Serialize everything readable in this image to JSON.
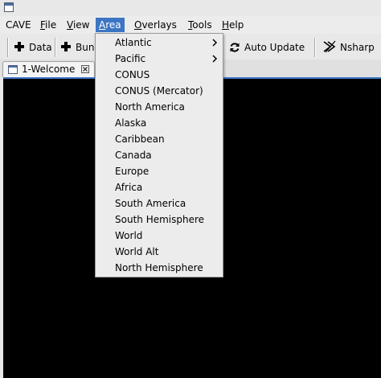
{
  "menubar": {
    "items": [
      {
        "label": "CAVE",
        "mnemonic": "",
        "rest": "CAVE"
      },
      {
        "label": "File",
        "mnemonic": "F",
        "rest": "ile"
      },
      {
        "label": "View",
        "mnemonic": "V",
        "rest": "iew"
      },
      {
        "label": "Area",
        "mnemonic": "A",
        "rest": "rea"
      },
      {
        "label": "Overlays",
        "mnemonic": "O",
        "rest": "verlays"
      },
      {
        "label": "Tools",
        "mnemonic": "T",
        "rest": "ools"
      },
      {
        "label": "Help",
        "mnemonic": "H",
        "rest": "elp"
      }
    ],
    "active": "Area"
  },
  "toolbar": {
    "data_label": "Data",
    "bundles_label": "Bun",
    "auto_update_label": "Auto Update",
    "nsharp_label": "Nsharp"
  },
  "tabs": [
    {
      "label": "1-Welcome",
      "icon": "window-icon"
    }
  ],
  "area_menu": {
    "items": [
      {
        "label": "Atlantic",
        "submenu": true
      },
      {
        "label": "Pacific",
        "submenu": true
      },
      {
        "label": "CONUS",
        "submenu": false
      },
      {
        "label": "CONUS (Mercator)",
        "submenu": false
      },
      {
        "label": "North America",
        "submenu": false
      },
      {
        "label": "Alaska",
        "submenu": false
      },
      {
        "label": "Caribbean",
        "submenu": false
      },
      {
        "label": "Canada",
        "submenu": false
      },
      {
        "label": "Europe",
        "submenu": false
      },
      {
        "label": "Africa",
        "submenu": false
      },
      {
        "label": "South America",
        "submenu": false
      },
      {
        "label": "South Hemisphere",
        "submenu": false
      },
      {
        "label": "World",
        "submenu": false
      },
      {
        "label": "World Alt",
        "submenu": false
      },
      {
        "label": "North Hemisphere",
        "submenu": false
      }
    ]
  },
  "colors": {
    "menu_highlight": "#3d75c4",
    "canvas_background": "#000000"
  }
}
